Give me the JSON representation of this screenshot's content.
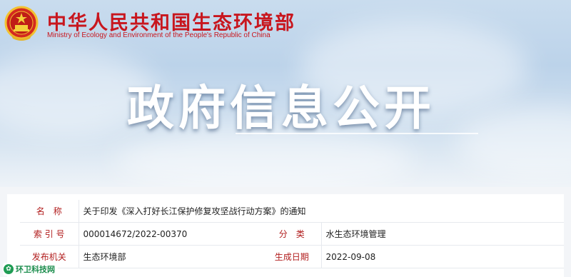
{
  "header": {
    "ministry_cn": "中华人民共和国生态环境部",
    "ministry_en": "Ministry of Ecology and Environment of the People's Republic of China",
    "emblem_icon": "national-emblem-icon"
  },
  "banner": {
    "title": "政府信息公开"
  },
  "info_table": {
    "rows": [
      {
        "label": "名　称",
        "value": "关于印发《深入打好长江保护修复攻坚战行动方案》的通知"
      },
      {
        "label": "索 引 号",
        "value": "000014672/2022-00370",
        "label2": "分　类",
        "value2": "水生态环境管理"
      },
      {
        "label": "发布机关",
        "value": "生态环境部",
        "label2": "生成日期",
        "value2": "2022-09-08"
      }
    ]
  },
  "watermark": {
    "text": "环卫科技网",
    "logo_icon": "green-leaf-logo-icon"
  },
  "colors": {
    "brand_red": "#c8161e",
    "label_red": "#b11c1c",
    "banner_blue": "#bcd3ea",
    "watermark_green": "#1b8d4d"
  }
}
